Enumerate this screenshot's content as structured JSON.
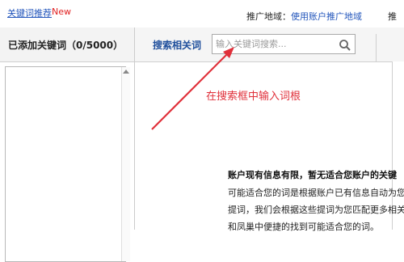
{
  "topbar": {
    "link": "关键词推荐",
    "new_badge": "New",
    "region_label": "推广地域：",
    "region_link": "使用账户推广地域",
    "cut_text": "推"
  },
  "left": {
    "title": "已添加关键词（0/5000）"
  },
  "right": {
    "tab_label": "搜索相关词",
    "search_placeholder": "输入关键词搜索..."
  },
  "annotation": {
    "text": "在搜索框中输入词根",
    "color": "#e0303a"
  },
  "message": {
    "title": "账户现有信息有限，暂无适合您账户的关键",
    "lines": [
      "可能适合您的词是根据账户已有信息自动为您",
      "提词，我们会根据这些提词为您匹配更多相关",
      "和凤巢中便捷的找到可能适合您的词。"
    ]
  },
  "colors": {
    "link_blue": "#2255bb",
    "new_red": "#e02020",
    "tab_blue": "#1f4f9c"
  }
}
